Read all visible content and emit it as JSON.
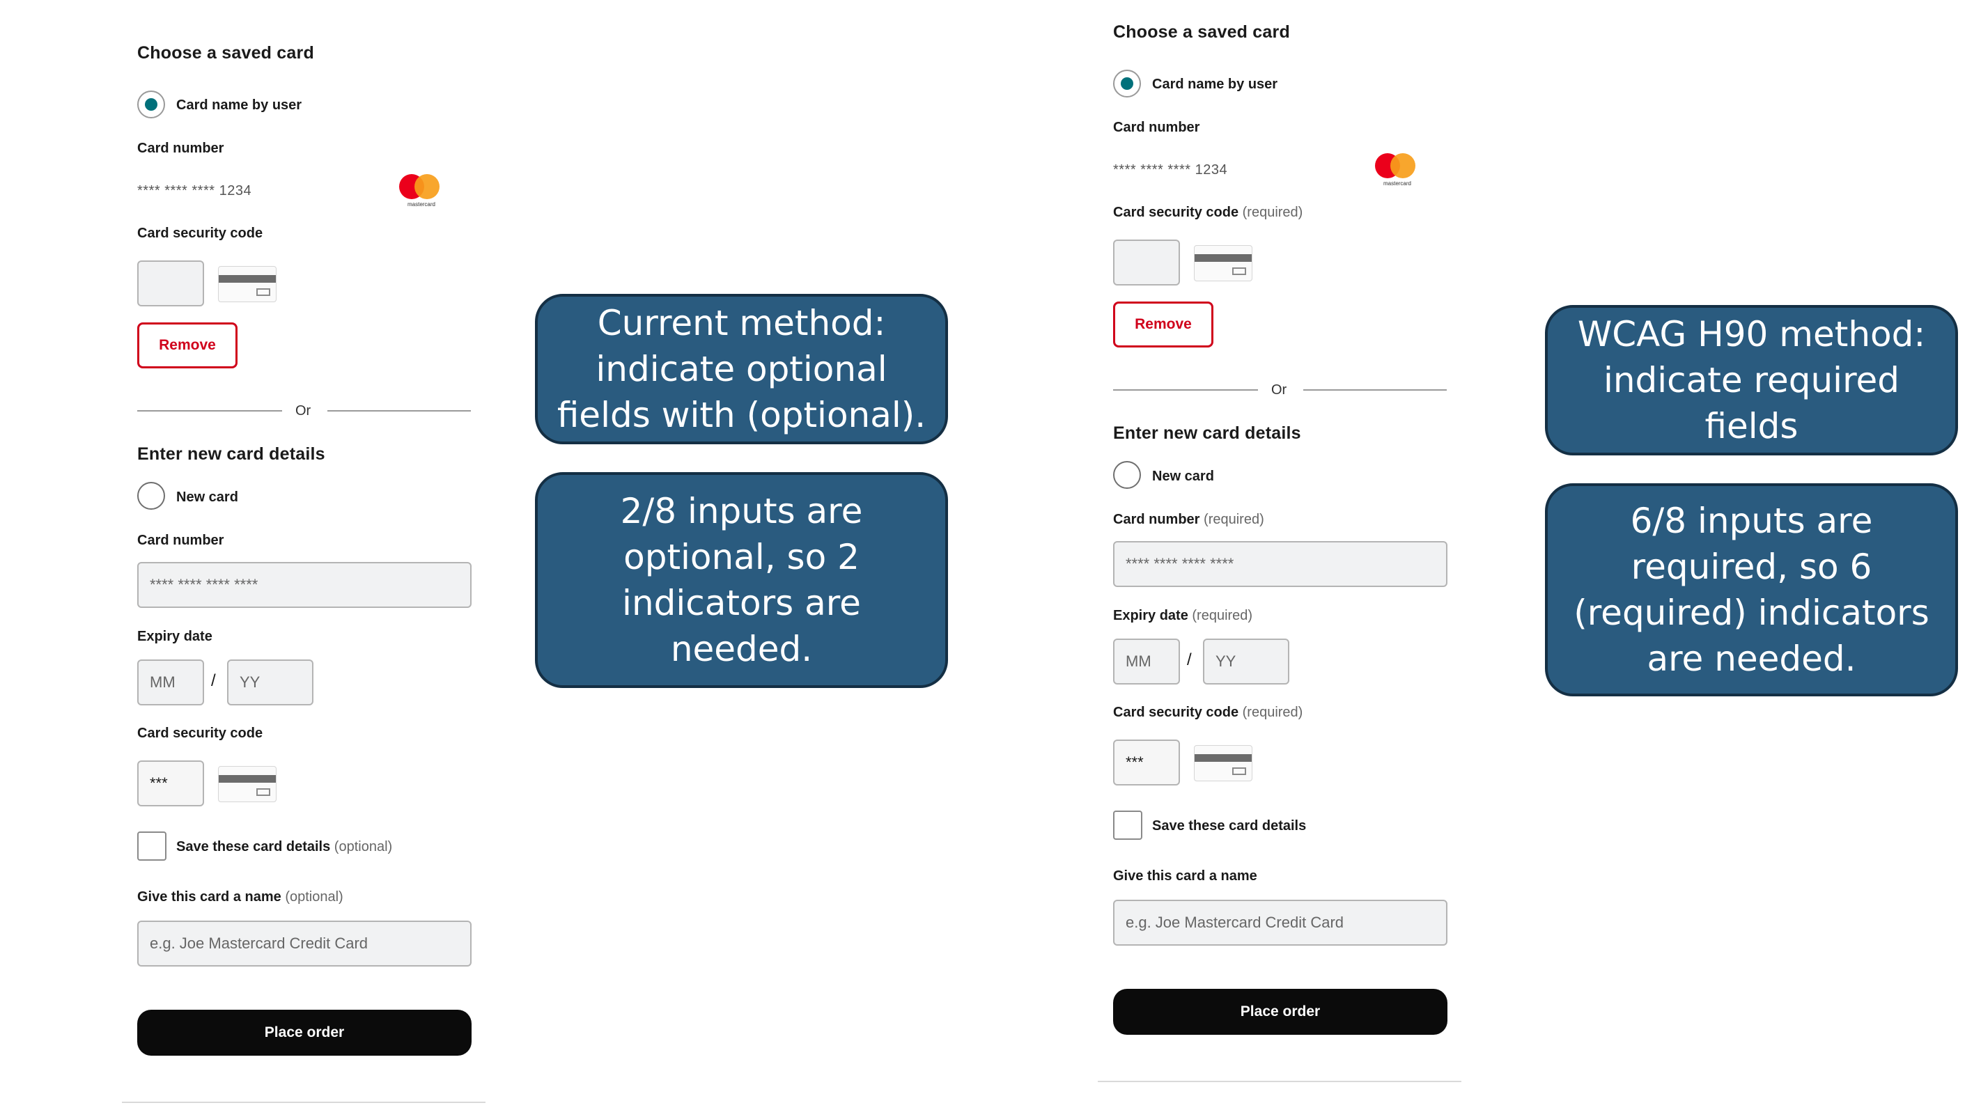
{
  "left_form": {
    "saved_heading": "Choose a saved card",
    "saved_radio_label": "Card name by user",
    "card_number_label": "Card number",
    "masked_number": "**** **** **** 1234",
    "brand_text": "mastercard",
    "security_label": "Card security code",
    "remove_label": "Remove",
    "or_label": "Or",
    "new_heading": "Enter new card details",
    "new_radio_label": "New card",
    "new_card_number_label": "Card number",
    "new_card_number_placeholder": "**** **** **** ****",
    "expiry_label": "Expiry date",
    "mm_placeholder": "MM",
    "slash": "/",
    "yy_placeholder": "YY",
    "new_security_label": "Card security code",
    "new_security_value": "***",
    "save_label": "Save these card details",
    "save_note": "(optional)",
    "name_label": "Give this card a name",
    "name_note": "(optional)",
    "name_placeholder": "e.g. Joe Mastercard Credit Card",
    "place_order_label": "Place order"
  },
  "right_form": {
    "saved_heading": "Choose a saved card",
    "saved_radio_label": "Card name by user",
    "card_number_label": "Card number",
    "masked_number": "**** **** **** 1234",
    "brand_text": "mastercard",
    "security_label": "Card security code",
    "security_note": "(required)",
    "remove_label": "Remove",
    "or_label": "Or",
    "new_heading": "Enter new card details",
    "new_radio_label": "New card",
    "new_card_number_label": "Card number",
    "new_card_number_note": "(required)",
    "new_card_number_placeholder": "**** **** **** ****",
    "expiry_label": "Expiry date",
    "expiry_note": "(required)",
    "mm_placeholder": "MM",
    "slash": "/",
    "yy_placeholder": "YY",
    "new_security_label": "Card security code",
    "new_security_note": "(required)",
    "new_security_value": "***",
    "save_label": "Save these card details",
    "name_label": "Give this card a name",
    "name_placeholder": "e.g. Joe Mastercard Credit Card",
    "place_order_label": "Place order"
  },
  "callouts": {
    "current_method": "Current method: indicate optional fields with (optional).",
    "current_count": "2/8 inputs are optional, so 2 indicators are needed.",
    "wcag_method": "WCAG H90 method: indicate required fields",
    "wcag_count": "6/8 inputs are required, so 6 (required) indicators are needed."
  },
  "colors": {
    "callout_fill": "#2a5b7f",
    "callout_border": "#142f44",
    "remove_red": "#d0021b",
    "radio_selected": "#00707a",
    "button_black": "#0b0b0b"
  },
  "icons": [
    "mastercard-logo-icon",
    "card-security-code-icon"
  ]
}
